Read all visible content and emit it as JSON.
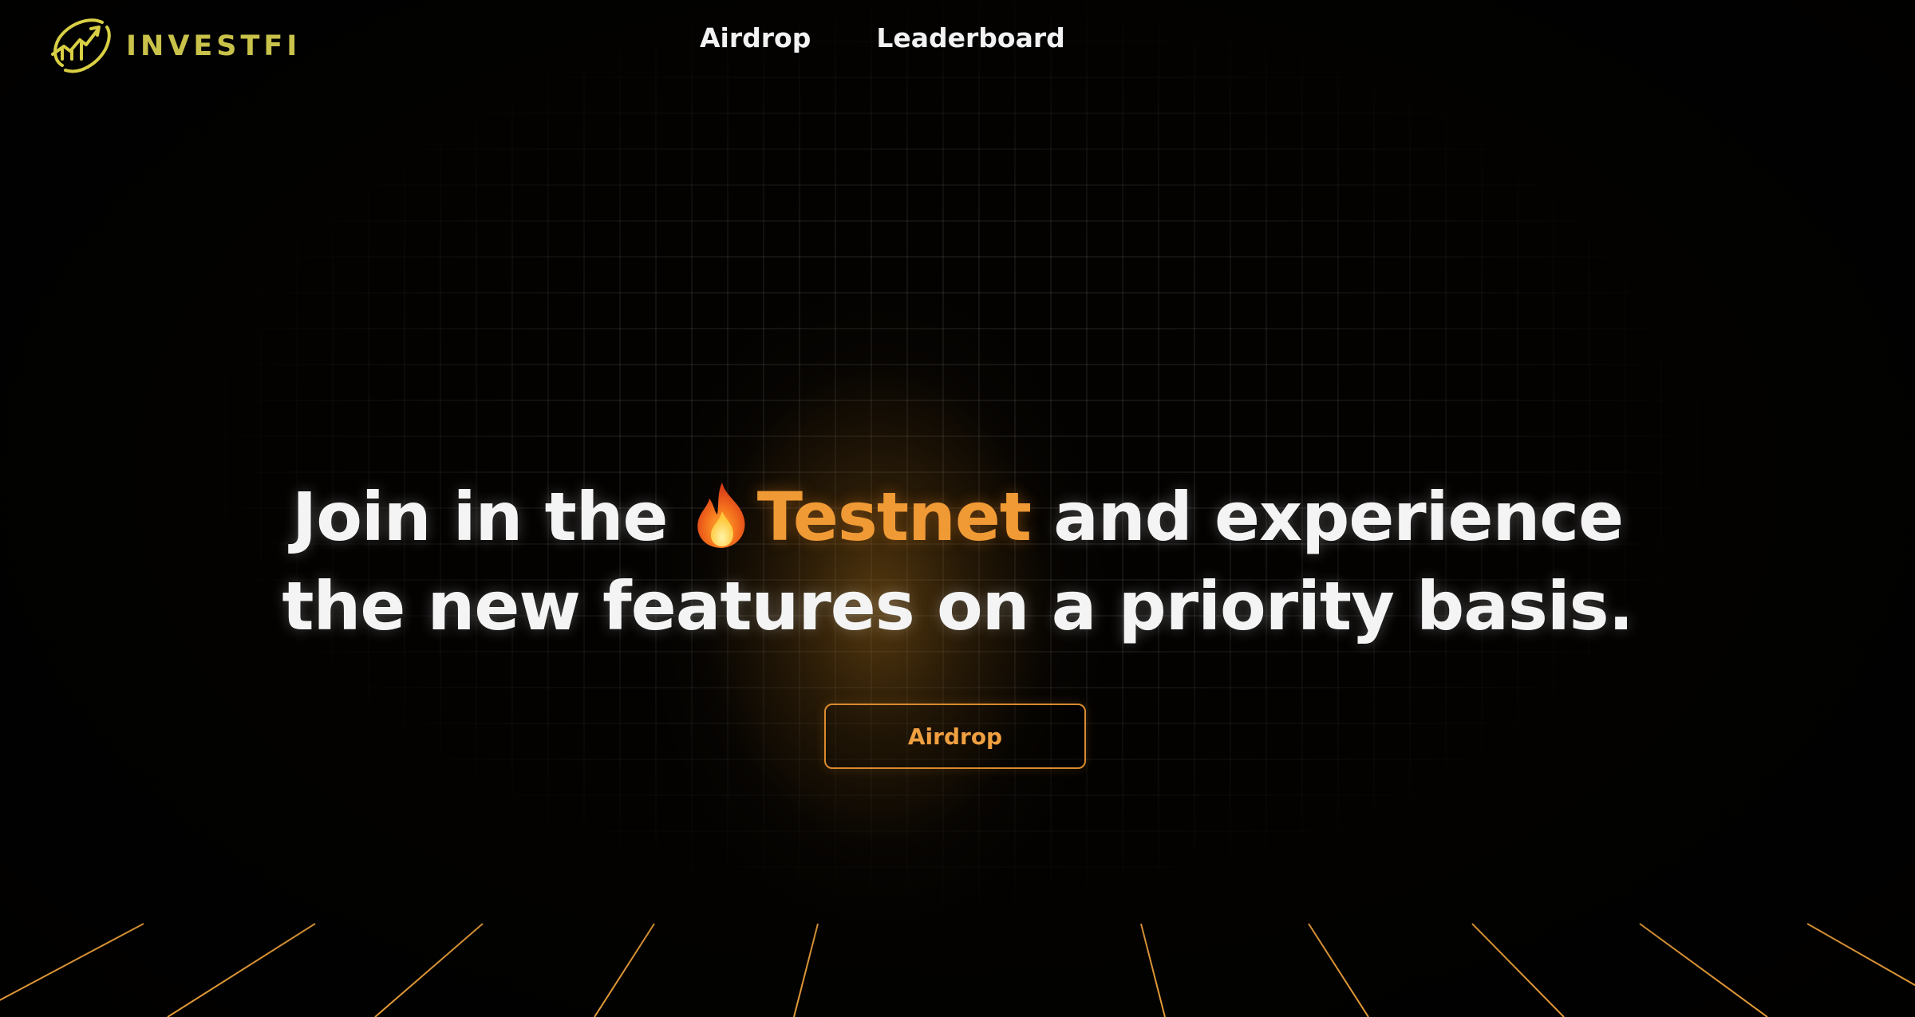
{
  "brand": {
    "name": "INVESTFI",
    "color": "#c9c24a"
  },
  "nav": {
    "items": [
      {
        "label": "Airdrop"
      },
      {
        "label": "Leaderboard"
      }
    ]
  },
  "hero": {
    "line1_prefix": "Join in the ",
    "highlight": "Testnet",
    "line1_suffix": " and experience",
    "line2": "the new features on a priority basis.",
    "icon": "fire-icon",
    "accent_color": "#f09a35"
  },
  "cta": {
    "label": "Airdrop"
  }
}
